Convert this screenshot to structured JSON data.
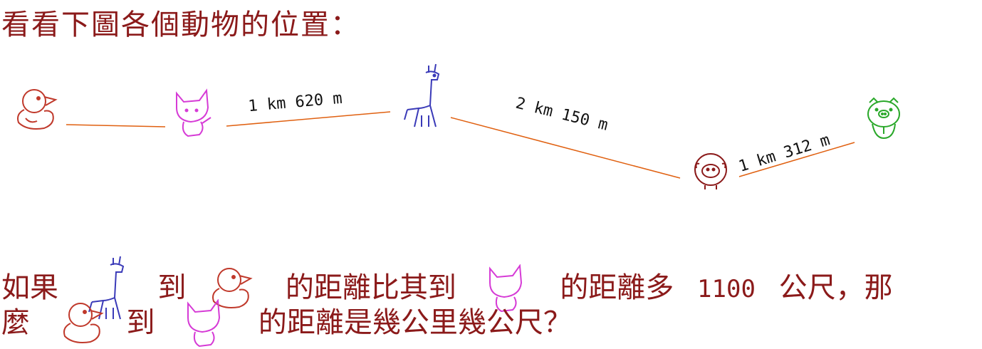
{
  "title": "看看下圖各個動物的位置：",
  "distances": {
    "giraffe_to_dog": "1 km  620 m",
    "giraffe_to_sheep": "2 km  150 m",
    "sheep_to_pig": "1 km  312 m"
  },
  "question": {
    "p1": "如果",
    "p2": "到",
    "p3": "的距離比其到",
    "p4": "的距離多",
    "number": "1100",
    "p5": "公尺，那",
    "p6": "麼",
    "p7": "到",
    "p8": "的距離是幾公里幾公尺？"
  },
  "colors": {
    "text": "#8b1a1a",
    "line": "#e06010",
    "duck": "#c0392b",
    "dog": "#d63bd6",
    "giraffe": "#3a3ab8",
    "sheep": "#8b1a1a",
    "pig": "#2aa82a"
  }
}
